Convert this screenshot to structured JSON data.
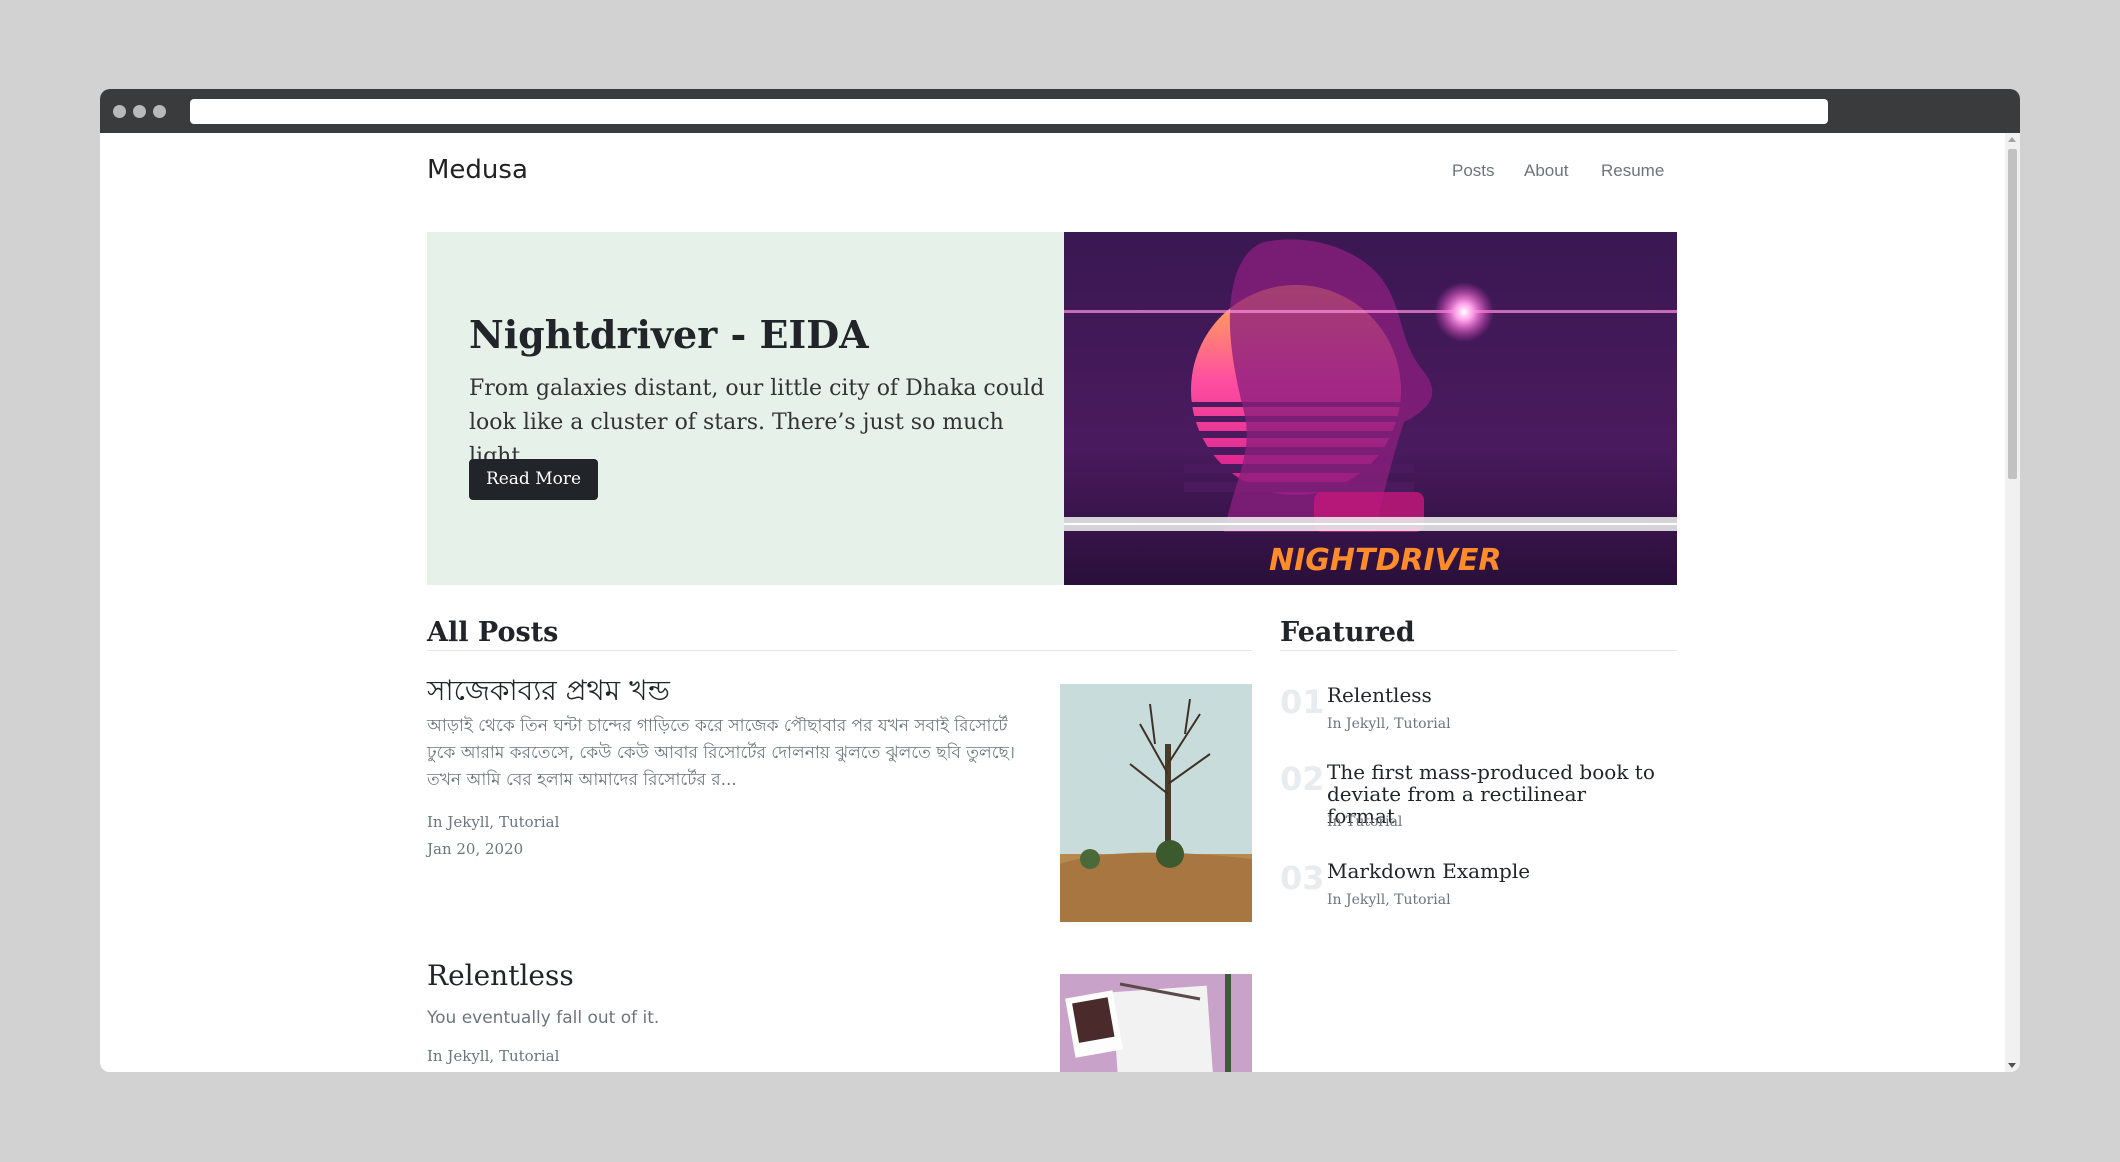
{
  "header": {
    "brand": "Medusa",
    "nav": [
      "Posts",
      "About",
      "Resume"
    ]
  },
  "hero": {
    "title": "Nightdriver - EIDA",
    "description": "From galaxies distant, our little city of Dhaka could look like a cluster of stars. There’s just so much light.",
    "button_label": "Read More",
    "image_text": "NIGHTDRIVER"
  },
  "all_posts": {
    "heading": "All Posts",
    "posts": [
      {
        "title": "সাজেকাব্যর প্রথম খন্ড",
        "excerpt": "আড়াই থেকে তিন ঘন্টা চান্দের গাড়িতে করে সাজেক পৌছাবার পর যখন সবাই রিসোর্টে ঢুকে আরাম করতেসে, কেউ কেউ আবার রিসোর্টের দোলনায় ঝুলতে ঝুলতে ছবি তুলছে। তখন আমি বের হলাম আমাদের রিসোর্টের র...",
        "categories": "In Jekyll, Tutorial",
        "date": "Jan 20, 2020"
      },
      {
        "title": "Relentless",
        "excerpt": "You eventually fall out of it.",
        "categories": "In Jekyll, Tutorial",
        "date": ""
      }
    ]
  },
  "featured": {
    "heading": "Featured",
    "items": [
      {
        "num": "01",
        "title": "Relentless",
        "categories": "In Jekyll, Tutorial"
      },
      {
        "num": "02",
        "title": "The first mass-produced book to deviate from a rectilinear format",
        "categories": "In Tutorial"
      },
      {
        "num": "03",
        "title": "Markdown Example",
        "categories": "In Jekyll, Tutorial"
      }
    ]
  },
  "colors": {
    "hero_bg": "#e6f1ea",
    "button_bg": "#212529",
    "titlebar": "#3a3b3d"
  }
}
